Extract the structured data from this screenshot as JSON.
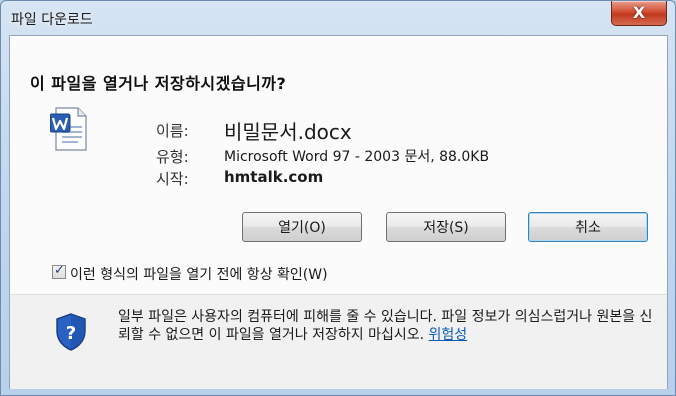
{
  "window": {
    "title": "파일 다운로드",
    "close_glyph": "X"
  },
  "dialog": {
    "heading": "이 파일을 열거나 저장하시겠습니까?",
    "file": {
      "name_label": "이름:",
      "name_value": "비밀문서.docx",
      "type_label": "유형:",
      "type_value": "Microsoft Word 97 - 2003 문서, 88.0KB",
      "from_label": "시작:",
      "from_value": "hmtalk.com",
      "icon": "word-document-icon"
    },
    "buttons": {
      "open": "열기(O)",
      "save": "저장(S)",
      "cancel": "취소"
    },
    "checkbox": {
      "label": "이런 형식의 파일을 열기 전에 항상 확인(W)",
      "checked": true
    },
    "warning": {
      "text": "일부 파일은 사용자의 컴퓨터에 피해를 줄 수 있습니다. 파일 정보가 의심스럽거나 원본을 신뢰할 수 없으면 이 파일을 열거나 저장하지 마십시오.",
      "link": "위험성",
      "icon": "security-shield-icon"
    }
  },
  "colors": {
    "frame": "#bfd3ea",
    "close_button": "#c13a1f",
    "link": "#0b5ab5"
  }
}
